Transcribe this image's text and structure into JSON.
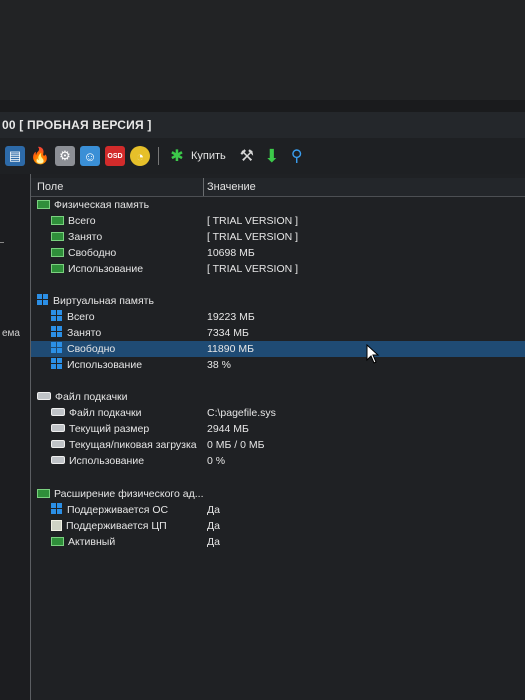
{
  "window": {
    "title": "00  [ ПРОБНАЯ ВЕРСИЯ ]"
  },
  "toolbar": {
    "buy_label": "Купить",
    "icons": [
      "report-icon",
      "flame-icon",
      "gears-icon",
      "user-icon",
      "osd-icon",
      "gauge-icon",
      "buy-icon",
      "tools-icon",
      "download-icon",
      "search-icon"
    ]
  },
  "leftpane": {
    "fragment": "ема"
  },
  "table": {
    "headers": {
      "field": "Поле",
      "value": "Значение"
    },
    "sections": [
      {
        "title": "Физическая память",
        "icon": "ram-icon",
        "rows": [
          {
            "field": "Всего",
            "value": "[ TRIAL VERSION ]"
          },
          {
            "field": "Занято",
            "value": "[ TRIAL VERSION ]"
          },
          {
            "field": "Свободно",
            "value": "10698 МБ"
          },
          {
            "field": "Использование",
            "value": "[ TRIAL VERSION ]"
          }
        ]
      },
      {
        "title": "Виртуальная память",
        "icon": "windows-icon",
        "rows": [
          {
            "field": "Всего",
            "value": "19223 МБ"
          },
          {
            "field": "Занято",
            "value": "7334 МБ"
          },
          {
            "field": "Свободно",
            "value": "11890 МБ"
          },
          {
            "field": "Использование",
            "value": "38 %"
          }
        ]
      },
      {
        "title": "Файл подкачки",
        "icon": "drive-icon",
        "rows": [
          {
            "field": "Файл подкачки",
            "value": "C:\\pagefile.sys"
          },
          {
            "field": "Текущий размер",
            "value": "2944 МБ"
          },
          {
            "field": "Текущая/пиковая загрузка",
            "value": "0 МБ / 0 МБ"
          },
          {
            "field": "Использование",
            "value": "0 %"
          }
        ]
      },
      {
        "title": "Расширение физического ад...",
        "icon": "ram-icon",
        "rows": [
          {
            "field": "Поддерживается ОС",
            "value": "Да"
          },
          {
            "field": "Поддерживается ЦП",
            "value": "Да"
          },
          {
            "field": "Активный",
            "value": "Да"
          }
        ]
      }
    ]
  },
  "colors": {
    "selection": "#1f4b74",
    "ram_green": "#2f8f3a",
    "windows_blue": "#2b8fe6"
  }
}
